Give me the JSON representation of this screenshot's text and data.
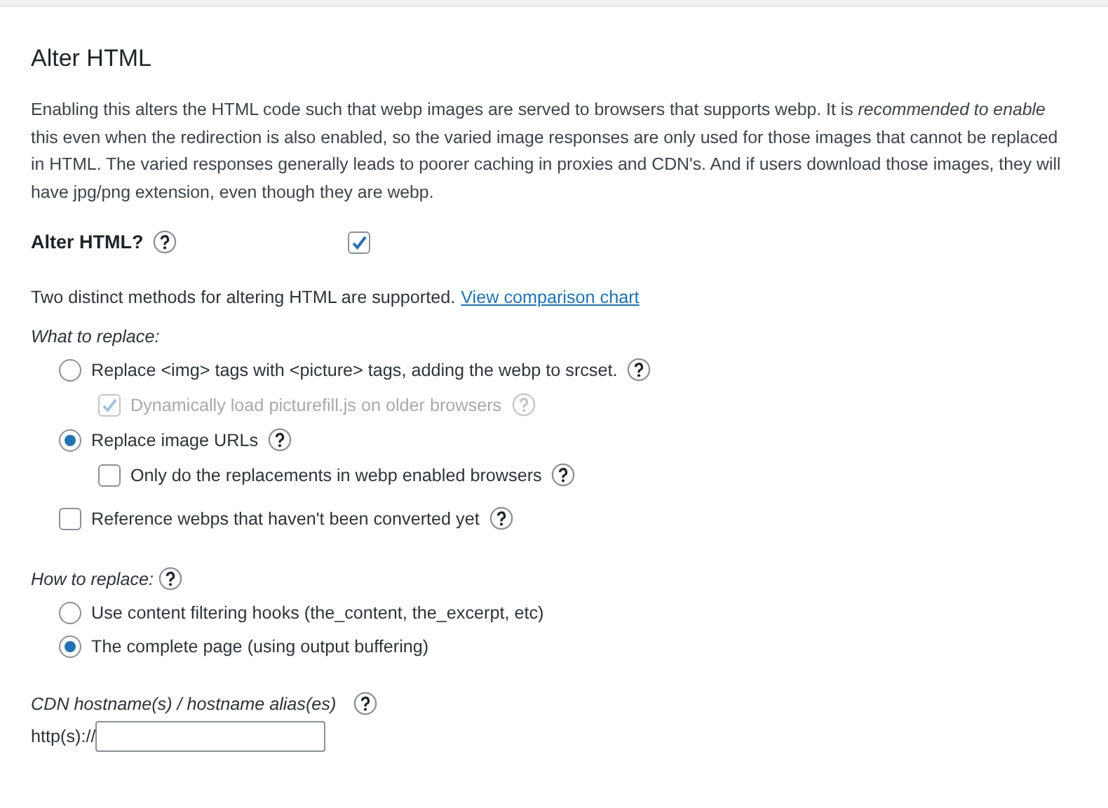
{
  "section": {
    "title": "Alter HTML",
    "description": "Enabling this alters the HTML code such that webp images are served to browsers that supports webp. It is *recommended to enable* this even when the redirection is also enabled, so the varied image responses are only used for those images that cannot be replaced in HTML. The varied responses generally leads to poorer caching in proxies and CDN's. And if users download those images, they will have jpg/png extension, even though they are webp."
  },
  "alter_html": {
    "label": "Alter HTML?",
    "help": true,
    "checked": true
  },
  "methods_note": {
    "text": "Two distinct methods for altering HTML are supported.",
    "link": "View comparison chart"
  },
  "what_to_replace": {
    "label": "What to replace:",
    "options": [
      {
        "kind": "radio",
        "label": "Replace <img> tags with <picture> tags, adding the webp to srcset.",
        "selected": false,
        "disabled": false,
        "help": true,
        "children": [
          {
            "kind": "checkbox",
            "label": "Dynamically load picturefill.js on older browsers",
            "checked": true,
            "disabled": true,
            "help": true
          }
        ]
      },
      {
        "kind": "radio",
        "label": "Replace image URLs",
        "selected": true,
        "disabled": false,
        "help": true,
        "children": [
          {
            "kind": "checkbox",
            "label": "Only do the replacements in webp enabled browsers",
            "checked": false,
            "disabled": false,
            "help": true
          }
        ]
      },
      {
        "kind": "checkbox",
        "label": "Reference webps that haven't been converted yet",
        "checked": false,
        "disabled": false,
        "help": true
      }
    ]
  },
  "how_to_replace": {
    "label": "How to replace:",
    "help": true,
    "options": [
      {
        "kind": "radio",
        "label": "Use content filtering hooks (the_content, the_excerpt, etc)",
        "selected": false,
        "disabled": false,
        "help": false
      },
      {
        "kind": "radio",
        "label": "The complete page (using output buffering)",
        "selected": true,
        "disabled": false,
        "help": false
      }
    ]
  },
  "cdn": {
    "label": "CDN hostname(s) / hostname alias(es)",
    "help": true,
    "prefix": "http(s)://"
  }
}
